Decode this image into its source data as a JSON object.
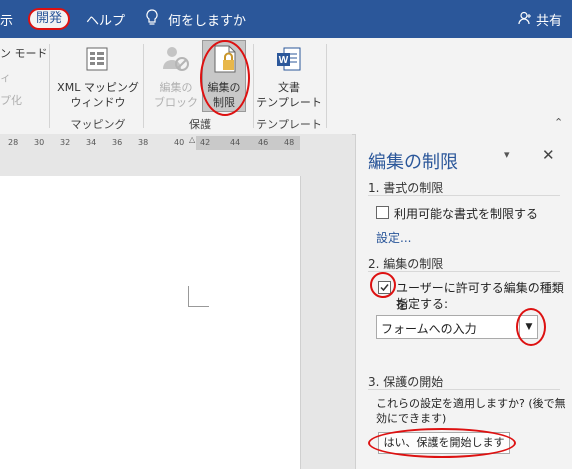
{
  "tabs": {
    "partial_left": "示",
    "developer": "開発",
    "help": "ヘルプ",
    "tell_me": "何をしますか",
    "share": "共有"
  },
  "ribbon": {
    "left_partial_1": "ン モード",
    "left_partial_2": "ィ",
    "left_partial_3": "プ化",
    "xml_mapping_line1": "XML マッピング",
    "xml_mapping_line2": "ウィンドウ",
    "mapping_group": "マッピング",
    "block_authors_line1": "編集の",
    "block_authors_line2": "ブロック",
    "restrict_editing_line1": "編集の",
    "restrict_editing_line2": "制限",
    "protect_group": "保護",
    "doc_template_line1": "文書",
    "doc_template_line2": "テンプレート",
    "template_group": "テンプレート"
  },
  "ruler": [
    "28",
    "30",
    "32",
    "34",
    "36",
    "38",
    "40",
    "42",
    "44",
    "46",
    "48"
  ],
  "pane": {
    "title": "編集の制限",
    "section1": "1. 書式の制限",
    "section1_option": "利用可能な書式を制限する",
    "section1_link": "設定...",
    "section2": "2. 編集の制限",
    "section2_option_line1": "ユーザーに許可する編集の種類を",
    "section2_option_line2": "指定する:",
    "section2_select": "フォームへの入力",
    "section3": "3. 保護の開始",
    "section3_text_line1": "これらの設定を適用しますか? (後で無",
    "section3_text_line2": "効にできます)",
    "section3_button": "はい、保護を開始します"
  },
  "colors": {
    "brand": "#2b579a",
    "highlight": "#dd1111"
  }
}
